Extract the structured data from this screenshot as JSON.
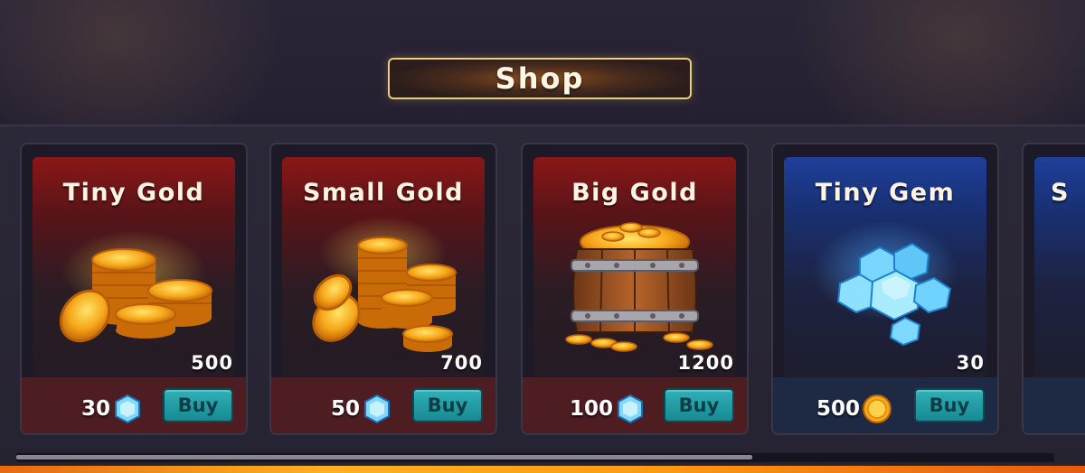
{
  "shop": {
    "title": "Shop"
  },
  "cards": [
    {
      "name": "Tiny Gold",
      "amount": "500",
      "price": "30",
      "currency_icon": "gem-icon",
      "buy_label": "Buy",
      "theme": "red",
      "reward_icon": "gold-coin-pile-icon"
    },
    {
      "name": "Small Gold",
      "amount": "700",
      "price": "50",
      "currency_icon": "gem-icon",
      "buy_label": "Buy",
      "theme": "red",
      "reward_icon": "gold-coin-stacks-icon"
    },
    {
      "name": "Big Gold",
      "amount": "1200",
      "price": "100",
      "currency_icon": "gem-icon",
      "buy_label": "Buy",
      "theme": "red",
      "reward_icon": "gold-barrel-icon"
    },
    {
      "name": "Tiny Gem",
      "amount": "30",
      "price": "500",
      "currency_icon": "gold-coin-icon",
      "buy_label": "Buy",
      "theme": "blue",
      "reward_icon": "gem-pile-icon"
    }
  ],
  "partial_card": {
    "name_fragment": "S"
  },
  "colors": {
    "title_border": "#e8cf7a",
    "red_theme": "#8a1717",
    "blue_theme": "#1e3f9a",
    "buy_button": "#2fb0b7",
    "coin": "#f7a81b",
    "gem": "#6fd2ff"
  },
  "scroll": {
    "position_fraction": 0.71
  }
}
